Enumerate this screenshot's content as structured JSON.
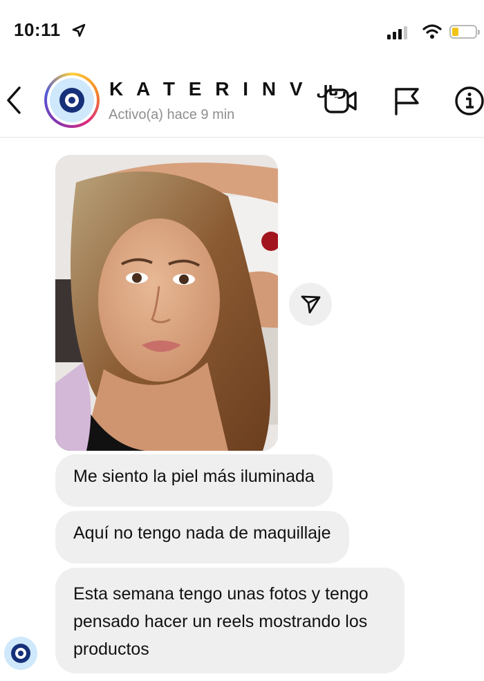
{
  "status_bar": {
    "time": "10:11"
  },
  "header": {
    "name": "K A T E R I N  V",
    "name_suffix": "ريال",
    "activity": "Activo(a) hace 9 min",
    "icons": [
      "back-chevron-icon",
      "video-camera-icon",
      "flag-icon",
      "info-icon"
    ]
  },
  "conversation": {
    "messages": [
      "Me siento la piel más iluminada",
      "Aquí no tengo nada de maquillaje",
      "Esta semana tengo unas fotos y tengo pensado hacer un reels mostrando los productos"
    ]
  },
  "colors": {
    "bubble": "#efefef",
    "secondary_text": "#8e8e8e",
    "battery": "#f0c419",
    "evil_eye_blue": "#16307a",
    "evil_eye_light": "#cfe8fb"
  }
}
